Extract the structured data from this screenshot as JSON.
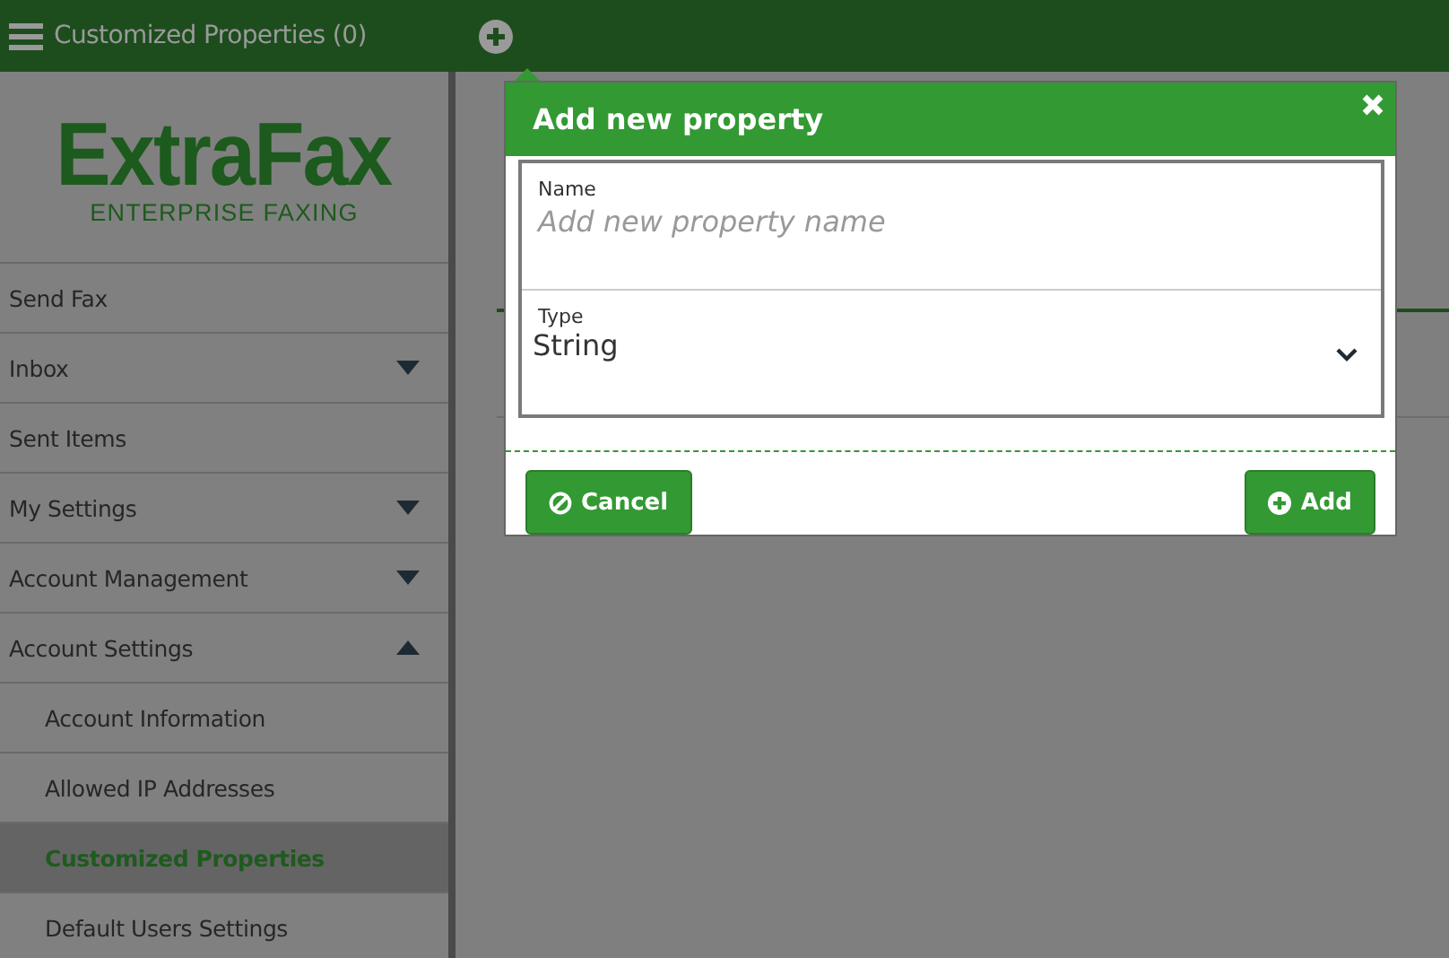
{
  "top_bar": {
    "title": "Customized Properties (0)"
  },
  "logo": {
    "name": "ExtraFax",
    "tagline": "ENTERPRISE FAXING"
  },
  "sidebar": {
    "items": [
      {
        "label": "Send Fax",
        "kind": "link",
        "selected": false
      },
      {
        "label": "Inbox",
        "kind": "group",
        "expanded": false,
        "selected": false
      },
      {
        "label": "Sent Items",
        "kind": "link",
        "selected": false
      },
      {
        "label": "My Settings",
        "kind": "group",
        "expanded": false,
        "selected": false
      },
      {
        "label": "Account Management",
        "kind": "group",
        "expanded": false,
        "selected": false
      },
      {
        "label": "Account Settings",
        "kind": "group",
        "expanded": true,
        "selected": false,
        "children": [
          {
            "label": "Account Information",
            "selected": false
          },
          {
            "label": "Allowed IP Addresses",
            "selected": false
          },
          {
            "label": "Customized Properties",
            "selected": true
          },
          {
            "label": "Default Users Settings",
            "selected": false
          }
        ]
      }
    ]
  },
  "dialog": {
    "title": "Add new property",
    "fields": [
      {
        "kind": "text",
        "label": "Name",
        "placeholder": "Add new property name"
      },
      {
        "kind": "select",
        "label": "Type",
        "value": "String"
      }
    ],
    "buttons": [
      {
        "label": "Cancel",
        "kind": "cancel"
      },
      {
        "label": "Add",
        "kind": "add"
      }
    ]
  }
}
